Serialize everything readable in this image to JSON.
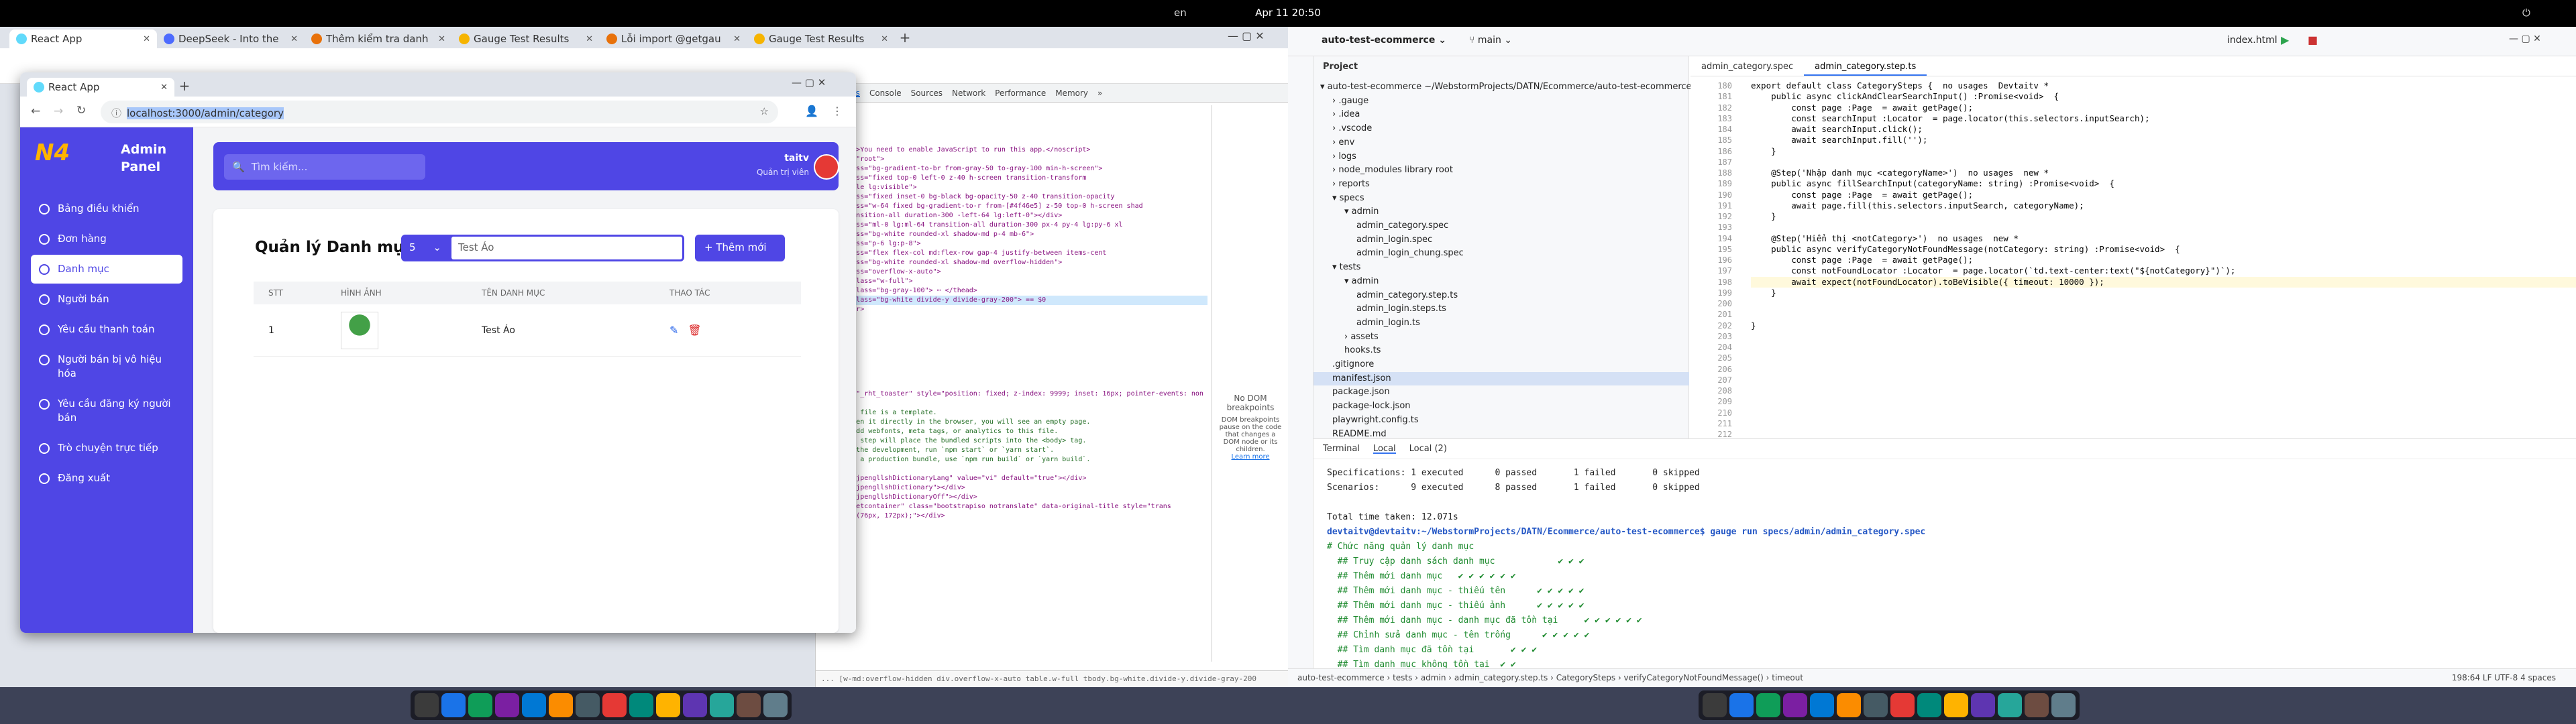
{
  "os": {
    "clock": "Apr 11  20:50",
    "lang": "en"
  },
  "chrome": {
    "tabs": [
      {
        "label": "React App",
        "color": "#61dafb"
      },
      {
        "label": "DeepSeek - Into the",
        "color": "#4d6bfe"
      },
      {
        "label": "Thêm kiểm tra danh",
        "color": "#e8710a"
      },
      {
        "label": "Gauge Test Results",
        "color": "#f6b400"
      },
      {
        "label": "Lỗi import @getgau",
        "color": "#e8710a"
      },
      {
        "label": "Gauge Test Results",
        "color": "#f6b400"
      }
    ],
    "new_tab": "+"
  },
  "devtools": {
    "tabs": [
      "Elements",
      "Console",
      "Sources",
      "Network",
      "Performance",
      "Memory",
      "»"
    ],
    "active_tab": "Elements",
    "dom_lines": [
      "    <script>",
      "    <",
      "    </head>",
      "  ▼<body>",
      "    <noscript>You need to enable JavaScript to run this app.</noscript>",
      "   ▼<div id=\"root\">",
      "     ▼<div class=\"bg-gradient-to-br from-gray-50 to-gray-100 min-h-screen\">",
      "       ▶<div class=\"fixed top-0 left-0 z-40 h-screen transition-transform",
      "        0 invisible lg:visible\">",
      "       ▼<div class=\"fixed inset-0 bg-black bg-opacity-50 z-40 transition-opacity",
      "       ▼<div class=\"w-64 fixed bg-gradient-to-r from-[#4f46e5] z-50 top-0 h-screen shad",
      "        ow-xl transition-all duration-300 -left-64 lg:left-0\"></div>",
      "       ▼<div class=\"ml-0 lg:ml-64 transition-all duration-300 px-4 py-4 lg:py-6 xl",
      "        ▼<div class=\"bg-white rounded-xl shadow-md p-4 mb-6\">",
      "          ▼<div class=\"p-6 lg:p-8\">",
      "            ▼<div class=\"flex flex-col md:flex-row gap-4 justify-between items-cent",
      "             ▶<div class=\"bg-white rounded-xl shadow-md overflow-hidden\">",
      "              ▼<div class=\"overflow-x-auto\">",
      "                ▼<table class=\"w-full\">",
      "                  ▶<thead class=\"bg-gray-100\"> ⋯ </thead>",
      "                  ▶<tbody class=\"bg-white divide-y divide-gray-200\"> == $0",
      "                    ▶<tr>⋯</tr>",
      "                    </tbody>",
      "                  </table>",
      "                </div>",
      "              </div>",
      "            </div>",
      "          </div>",
      "        </div>",
      "      </div>",
      "    ▶<div id=\"_rht_toaster\" style=\"position: fixed; z-index: 9999; inset: 16px; pointer-events: non",
      "    <!--",
      "      This HTML file is a template.",
      "      If you open it directly in the browser, you will see an empty page.",
      "",
      "      You can add webfonts, meta tags, or analytics to this file.",
      "      The build step will place the bundled scripts into the <body> tag.",
      "",
      "      To begin the development, run `npm start` or `yarn start`.",
      "      To create a production bundle, use `npm run build` or `yarn build`.",
      "    -->",
      "    <div id=\"jpengllshDictionaryLang\" value=\"vi\" default=\"true\"></div>",
      "    <div id=\"jpengllshDictionary\"></div>",
      "    <div id=\"jpengllshDictionaryOff\"></div>",
      "    <div id=\"etcontainer\" class=\"bootstrapiso notranslate\" data-original-title style=\"trans",
      "    translate(76px, 172px);\"></div>"
    ],
    "side_text": "No DOM breakpoints",
    "side_sub": "DOM breakpoints pause on the code that changes a DOM node or its children.",
    "side_link": "Learn more",
    "breadcrumb": "... [w-md:overflow-hidden   div.overflow-x-auto   table.w-full   tbody.bg-white.divide-y.divide-gray-200"
  },
  "popup": {
    "tab_label": "React App",
    "url": "localhost:3000/admin/category",
    "sidebar": {
      "logo": "N4",
      "brand": "Admin Panel",
      "items": [
        {
          "label": "Bảng điều khiển",
          "active": false
        },
        {
          "label": "Đơn hàng",
          "active": false
        },
        {
          "label": "Danh mục",
          "active": true
        },
        {
          "label": "Người bán",
          "active": false
        },
        {
          "label": "Yêu cầu thanh toán",
          "active": false
        },
        {
          "label": "Người bán bị vô hiệu hóa",
          "active": false
        },
        {
          "label": "Yêu cầu đăng ký người bán",
          "active": false
        },
        {
          "label": "Trò chuyện trực tiếp",
          "active": false
        },
        {
          "label": "Đăng xuất",
          "active": false
        }
      ]
    },
    "header": {
      "search_placeholder": "Tìm kiếm...",
      "user_name": "taitv",
      "user_role": "Quản trị viên"
    },
    "main": {
      "title": "Quản lý Danh mục",
      "page_size": "5",
      "search_value": "Test Áo",
      "add_button": "+ Thêm mới",
      "columns": [
        "STT",
        "HÌNH ẢNH",
        "TÊN DANH MỤC",
        "THAO TÁC"
      ],
      "rows": [
        {
          "stt": "1",
          "name": "Test Áo"
        }
      ]
    }
  },
  "ide": {
    "project_name": "auto-test-ecommerce",
    "branch": "main",
    "run_config": "index.html",
    "project_label": "Project",
    "tree": [
      {
        "indent": 0,
        "text": "▾ auto-test-ecommerce  ~/WebstormProjects/DATN/Ecommerce/auto-test-ecommerce"
      },
      {
        "indent": 1,
        "text": "› .gauge"
      },
      {
        "indent": 1,
        "text": "› .idea"
      },
      {
        "indent": 1,
        "text": "› .vscode"
      },
      {
        "indent": 1,
        "text": "› env"
      },
      {
        "indent": 1,
        "text": "› logs"
      },
      {
        "indent": 1,
        "text": "› node_modules  library root"
      },
      {
        "indent": 1,
        "text": "› reports"
      },
      {
        "indent": 1,
        "text": "▾ specs"
      },
      {
        "indent": 2,
        "text": "▾ admin"
      },
      {
        "indent": 3,
        "text": "admin_category.spec"
      },
      {
        "indent": 3,
        "text": "admin_login.spec"
      },
      {
        "indent": 3,
        "text": "admin_login_chung.spec"
      },
      {
        "indent": 1,
        "text": "▾ tests"
      },
      {
        "indent": 2,
        "text": "▾ admin"
      },
      {
        "indent": 3,
        "text": "admin_category.step.ts"
      },
      {
        "indent": 3,
        "text": "admin_login.steps.ts"
      },
      {
        "indent": 3,
        "text": "admin_login.ts"
      },
      {
        "indent": 2,
        "text": "› assets"
      },
      {
        "indent": 2,
        "text": "hooks.ts"
      },
      {
        "indent": 1,
        "text": ".gitignore"
      },
      {
        "indent": 1,
        "text": "manifest.json"
      },
      {
        "indent": 1,
        "text": "package.json"
      },
      {
        "indent": 1,
        "text": "package-lock.json"
      },
      {
        "indent": 1,
        "text": "playwright.config.ts"
      },
      {
        "indent": 1,
        "text": "README.md"
      },
      {
        "indent": 1,
        "text": "tsconfig.json"
      }
    ],
    "selected_tree_index": 21,
    "editor_tabs": [
      {
        "label": "admin_category.spec",
        "active": false
      },
      {
        "label": "admin_category.step.ts",
        "active": true
      }
    ],
    "line_numbers": [
      "180",
      "181",
      "182",
      "183",
      "184",
      "185",
      "186",
      "187",
      "188",
      "189",
      "190",
      "191",
      "192",
      "193",
      "194",
      "195",
      "196",
      "197",
      "198",
      "199",
      "200",
      "201",
      "202",
      "203",
      "204",
      "205",
      "206",
      "207",
      "208",
      "209",
      "210",
      "211",
      "212"
    ],
    "code_lines": [
      "export default class CategorySteps {  no usages  Devtaitv *",
      "    public async clickAndClearSearchInput() :Promise<void>  {",
      "        const page :Page  = await getPage();",
      "        const searchInput :Locator  = page.locator(this.selectors.inputSearch);",
      "        await searchInput.click();",
      "        await searchInput.fill('');",
      "    }",
      "",
      "    @Step('Nhập danh mục <categoryName>')  no usages  new *",
      "    public async fillSearchInput(categoryName: string) :Promise<void>  {",
      "        const page :Page  = await getPage();",
      "        await page.fill(this.selectors.inputSearch, categoryName);",
      "    }",
      "",
      "    @Step('Hiển thị <notCategory>')  no usages  new *",
      "    public async verifyCategoryNotFoundMessage(notCategory: string) :Promise<void>  {",
      "        const page :Page  = await getPage();",
      "        const notFoundLocator :Locator  = page.locator(`td.text-center:text(\"${notCategory}\")`);",
      "        await expect(notFoundLocator).toBeVisible({ timeout: 10000 });",
      "    }",
      "",
      "",
      "}"
    ],
    "highlight_line_index": 18,
    "terminal": {
      "tabs": [
        "Terminal",
        "Local",
        "Local (2)"
      ],
      "active_tab": "Local",
      "lines": [
        {
          "t": "Specifications: 1 executed      0 passed       1 failed       0 skipped",
          "c": ""
        },
        {
          "t": "Scenarios:      9 executed      8 passed       1 failed       0 skipped",
          "c": ""
        },
        {
          "t": "",
          "c": ""
        },
        {
          "t": "Total time taken: 12.071s",
          "c": ""
        },
        {
          "t": "devtaitv@devtaitv:~/WebstormProjects/DATN/Ecommerce/auto-test-ecommerce$ gauge run specs/admin/admin_category.spec",
          "c": "b"
        },
        {
          "t": "# Chức năng quản lý danh mục",
          "c": "g"
        },
        {
          "t": "  ## Truy cập danh sách danh mục            ✔ ✔ ✔",
          "c": "g"
        },
        {
          "t": "  ## Thêm mới danh mục   ✔ ✔ ✔ ✔ ✔ ✔",
          "c": "g"
        },
        {
          "t": "  ## Thêm mới danh mục - thiếu tên      ✔ ✔ ✔ ✔ ✔",
          "c": "g"
        },
        {
          "t": "  ## Thêm mới danh mục - thiếu ảnh      ✔ ✔ ✔ ✔ ✔",
          "c": "g"
        },
        {
          "t": "  ## Thêm mới danh mục - danh mục đã tồn tại     ✔ ✔ ✔ ✔ ✔ ✔",
          "c": "g"
        },
        {
          "t": "  ## Chỉnh sửa danh mục - tên trống      ✔ ✔ ✔ ✔ ✔",
          "c": "g"
        },
        {
          "t": "  ## Tìm danh mục đã tồn tại       ✔ ✔ ✔",
          "c": "g"
        },
        {
          "t": "  ## Tìm danh mục không tồn tại  ✔ ✔",
          "c": "g"
        }
      ]
    },
    "status": {
      "path": "auto-test-ecommerce  ›  tests  ›  admin  ›  admin_category.step.ts  ›  CategorySteps  ›  verifyCategoryNotFoundMessage()  ›  timeout",
      "right": "198:64   LF   UTF-8   4 spaces"
    }
  }
}
